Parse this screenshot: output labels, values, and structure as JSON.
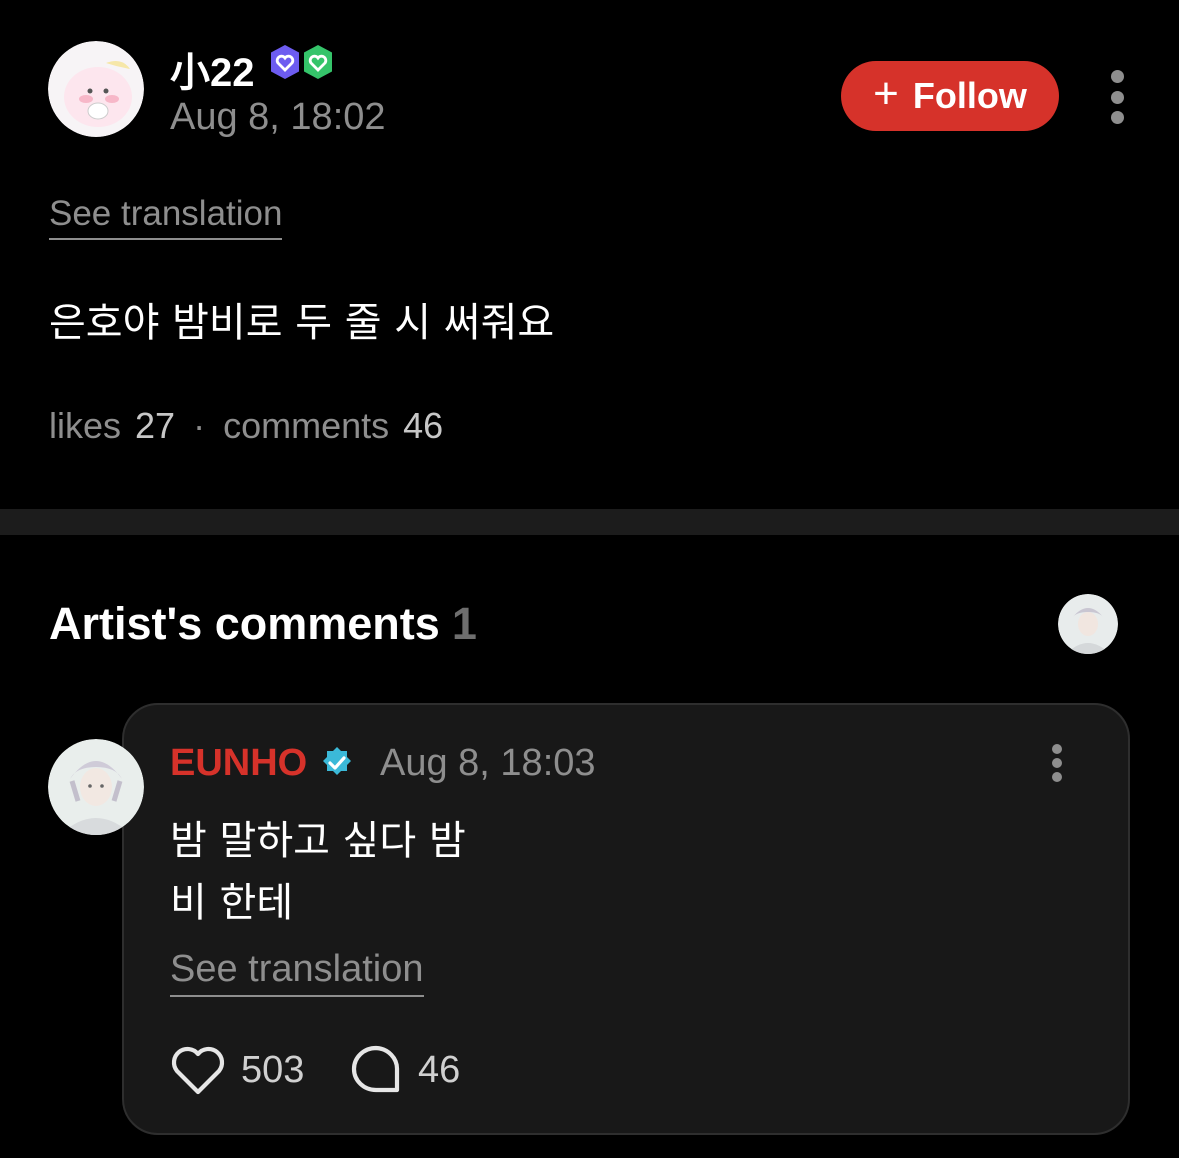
{
  "post": {
    "author": "小22",
    "timestamp": "Aug 8, 18:02",
    "follow_label": "Follow",
    "see_translation": "See translation",
    "body": "은호야 밤비로 두 줄 시 써줘요",
    "likes_label": "likes",
    "likes_count": "27",
    "separator": "·",
    "comments_label": "comments",
    "comments_count": "46",
    "badges": [
      "purple-heart-badge",
      "green-heart-badge"
    ]
  },
  "artist_comments": {
    "title": "Artist's comments",
    "count": "1"
  },
  "comment": {
    "author": "EUNHO",
    "author_color": "#d6322a",
    "verified_icon": "verified-badge-icon",
    "timestamp": "Aug 8, 18:03",
    "lines": [
      "밤 말하고 싶다 밤",
      "비 한테"
    ],
    "see_translation": "See translation",
    "likes": "503",
    "replies": "46"
  },
  "colors": {
    "background": "#000000",
    "accent_red": "#d6322a",
    "muted_text": "#8e8e8e",
    "card_background": "#181818",
    "divider": "#1c1c1c"
  }
}
